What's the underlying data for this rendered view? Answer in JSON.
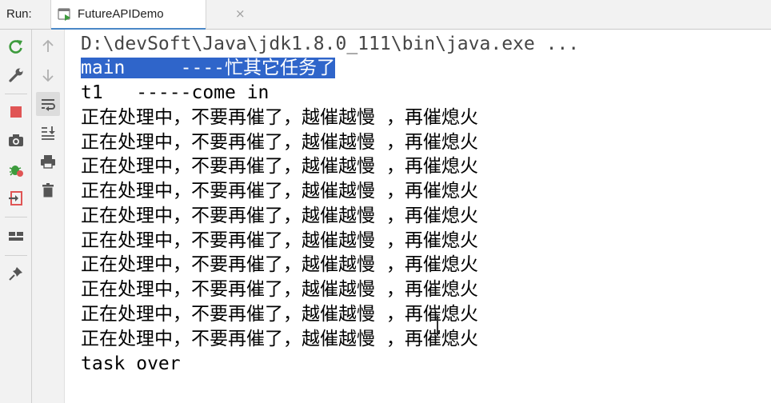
{
  "run_panel": {
    "label": "Run:",
    "tab": {
      "title": "FutureAPIDemo",
      "close": "×"
    }
  },
  "toolbar_left": {
    "icons": [
      "rerun-icon",
      "wrench-icon",
      "stop-icon",
      "camera-icon",
      "debug-icon",
      "exit-icon",
      "layout-icon",
      "pin-icon"
    ]
  },
  "toolbar_mid": {
    "icons": [
      "up-arrow-icon",
      "down-arrow-icon",
      "soft-wrap-icon",
      "scroll-to-end-icon",
      "print-icon",
      "trash-icon"
    ]
  },
  "console": {
    "command": "D:\\devSoft\\Java\\jdk1.8.0_111\\bin\\java.exe ...",
    "lines": [
      "main     ----忙其它任务了",
      "t1   -----come in",
      "正在处理中，不要再催了，越催越慢 ，再催熄火",
      "正在处理中，不要再催了，越催越慢 ，再催熄火",
      "正在处理中，不要再催了，越催越慢 ，再催熄火",
      "正在处理中，不要再催了，越催越慢 ，再催熄火",
      "正在处理中，不要再催了，越催越慢 ，再催熄火",
      "正在处理中，不要再催了，越催越慢 ，再催熄火",
      "正在处理中，不要再催了，越催越慢 ，再催熄火",
      "正在处理中，不要再催了，越催越慢 ，再催熄火",
      "正在处理中，不要再催了，越催越慢 ，再催熄火",
      "正在处理中，不要再催了，越催越慢 ，再催熄火",
      "task over"
    ]
  },
  "colors": {
    "selection": "#2f65ca",
    "tab_underline": "#4a88c7",
    "rerun_green": "#3d9b3d",
    "stop_red": "#e05555"
  }
}
